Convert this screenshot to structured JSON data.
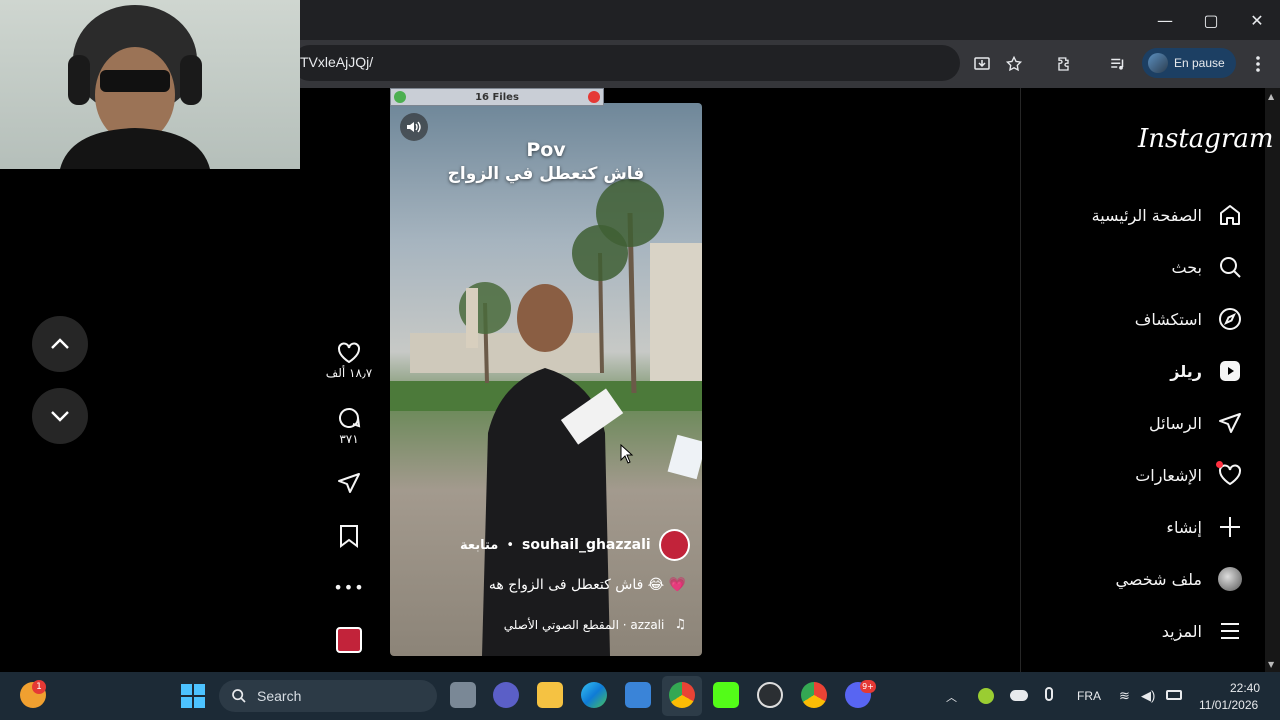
{
  "browser": {
    "url": "TVxleAjJQj/",
    "profile_label": "En pause",
    "window_controls": {
      "minimize": "—",
      "maximize": "▢",
      "close": "✕"
    }
  },
  "overlay_widget": {
    "label": "16 Files"
  },
  "instagram": {
    "logo": "Instagram",
    "nav": [
      {
        "label": "الصفحة الرئيسية",
        "icon": "home-icon"
      },
      {
        "label": "بحث",
        "icon": "search-icon"
      },
      {
        "label": "استكشاف",
        "icon": "compass-icon"
      },
      {
        "label": "ريلز",
        "icon": "reels-icon"
      },
      {
        "label": "الرسائل",
        "icon": "messages-icon"
      },
      {
        "label": "الإشعارات",
        "icon": "heart-icon"
      },
      {
        "label": "إنشاء",
        "icon": "plus-icon"
      },
      {
        "label": "ملف شخصي",
        "icon": "profile-avatar-icon"
      },
      {
        "label": "المزيد",
        "icon": "menu-icon"
      }
    ],
    "reel": {
      "overlay_title": "Pov",
      "overlay_subtitle": "فاش كتعطل في الزواج",
      "username": "souhail_ghazzali",
      "follow_label": "متابعة",
      "caption": "فاش كتعطل فى الزواج هه 😂 💗",
      "audio": "المقطع الصوتي الأصلي · azzali",
      "likes": "١٨٫٧ ألف",
      "comments": "٣٧١"
    }
  },
  "taskbar": {
    "search_placeholder": "Search",
    "language": "FRA",
    "time": "22:40",
    "date": "11/01/2026",
    "discord_badge": "9+",
    "weather_badge": "1"
  }
}
